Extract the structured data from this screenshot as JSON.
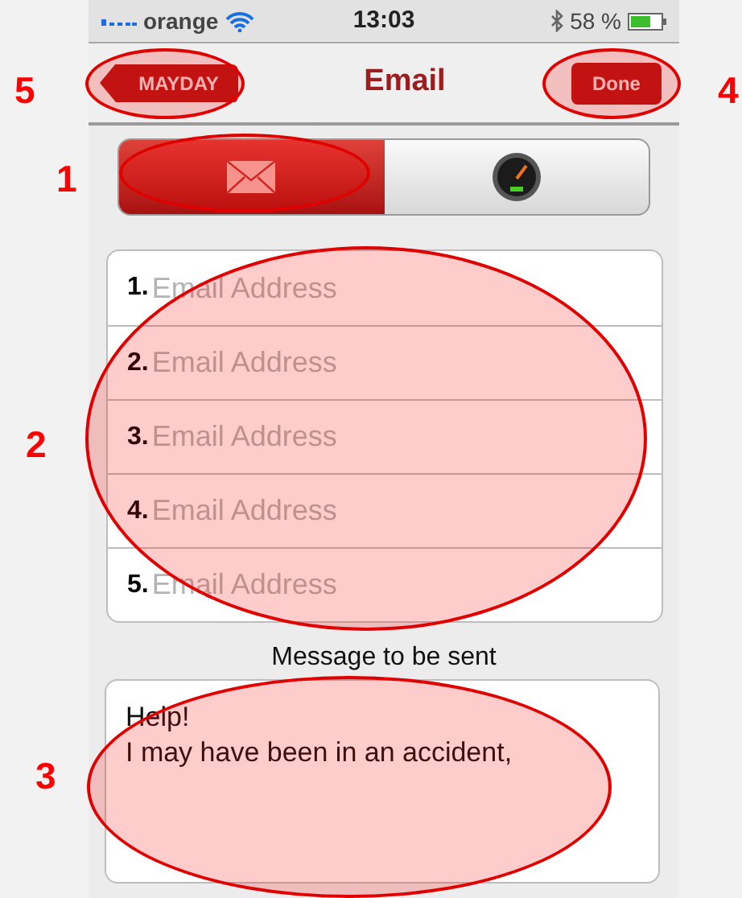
{
  "status_bar": {
    "carrier": "orange",
    "time": "13:03",
    "battery": "58 %"
  },
  "nav_bar": {
    "back_button": "MAYDAY",
    "title": "Email",
    "done_button": "Done"
  },
  "segmented_control": {
    "segments": [
      {
        "kind": "email",
        "selected": true
      },
      {
        "kind": "gauge",
        "selected": false
      }
    ]
  },
  "email_fields": [
    {
      "number": "1.",
      "placeholder": "Email Address"
    },
    {
      "number": "2.",
      "placeholder": "Email Address"
    },
    {
      "number": "3.",
      "placeholder": "Email Address"
    },
    {
      "number": "4.",
      "placeholder": "Email Address"
    },
    {
      "number": "5.",
      "placeholder": "Email Address"
    }
  ],
  "message_label": "Message to be sent",
  "message": {
    "value": "Help!\nI may have been in an accident,"
  },
  "annotations": [
    {
      "label": "5"
    },
    {
      "label": "4"
    },
    {
      "label": "1"
    },
    {
      "label": "2"
    },
    {
      "label": "3"
    }
  ]
}
